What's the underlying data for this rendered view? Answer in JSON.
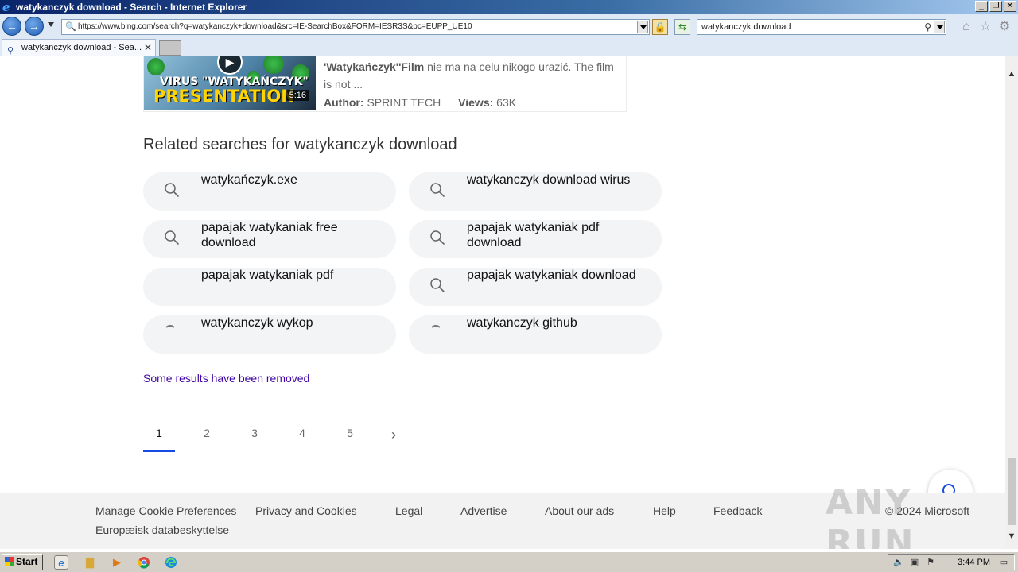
{
  "window": {
    "title": "watykanczyk download - Search - Internet Explorer",
    "minimize": "_",
    "restore": "❐",
    "close": "✕"
  },
  "navbar": {
    "back": "←",
    "forward": "→",
    "address": "https://www.bing.com/search?q=watykanczyk+download&src=IE-SearchBox&FORM=IESR3S&pc=EUPP_UE10",
    "search_value": "watykanczyk download"
  },
  "tab": {
    "label": "watykanczyk download - Sea...",
    "close": "✕"
  },
  "video": {
    "thumb_line1": "VIRUS \"WATYKAŃCZYK\"",
    "thumb_line2": "PRESENTATION",
    "duration": "5:16",
    "desc_bold": "'Watykańczyk''Film",
    "desc_rest": " nie ma na celu nikogo urazić. The film is not ...",
    "author_label": "Author:",
    "author": "SPRINT TECH",
    "views_label": "Views:",
    "views": "63K"
  },
  "related": {
    "title": "Related searches for watykanczyk download",
    "items": [
      {
        "label": "watykańczyk.exe",
        "icon": "search-icon"
      },
      {
        "label": "watykanczyk download wirus",
        "icon": "search-icon"
      },
      {
        "label": "papajak watykaniak free download",
        "icon": "search-icon"
      },
      {
        "label": "papajak watykaniak pdf download",
        "icon": "search-icon"
      },
      {
        "label": "papajak watykaniak pdf",
        "icon": "none"
      },
      {
        "label": "papajak watykaniak download",
        "icon": "search-icon"
      },
      {
        "label": "watykanczyk wykop",
        "icon": "loading-icon"
      },
      {
        "label": "watykanczyk github",
        "icon": "loading-icon"
      }
    ]
  },
  "removed_notice": "Some results have been removed",
  "pagination": {
    "pages": [
      "1",
      "2",
      "3",
      "4",
      "5"
    ],
    "current": "1",
    "next": "›"
  },
  "footer": {
    "links": [
      "Manage Cookie Preferences",
      "Privacy and Cookies",
      "Legal",
      "Advertise",
      "About our ads",
      "Help",
      "Feedback"
    ],
    "second_line": "Europæisk databeskyttelse",
    "copyright": "© 2024 Microsoft"
  },
  "watermark": "ANY RUN",
  "taskbar": {
    "start": "Start",
    "clock": "3:44 PM"
  },
  "colors": {
    "accent": "#174ae4",
    "visited_link": "#4007a2",
    "chip_bg": "#f3f4f5"
  }
}
